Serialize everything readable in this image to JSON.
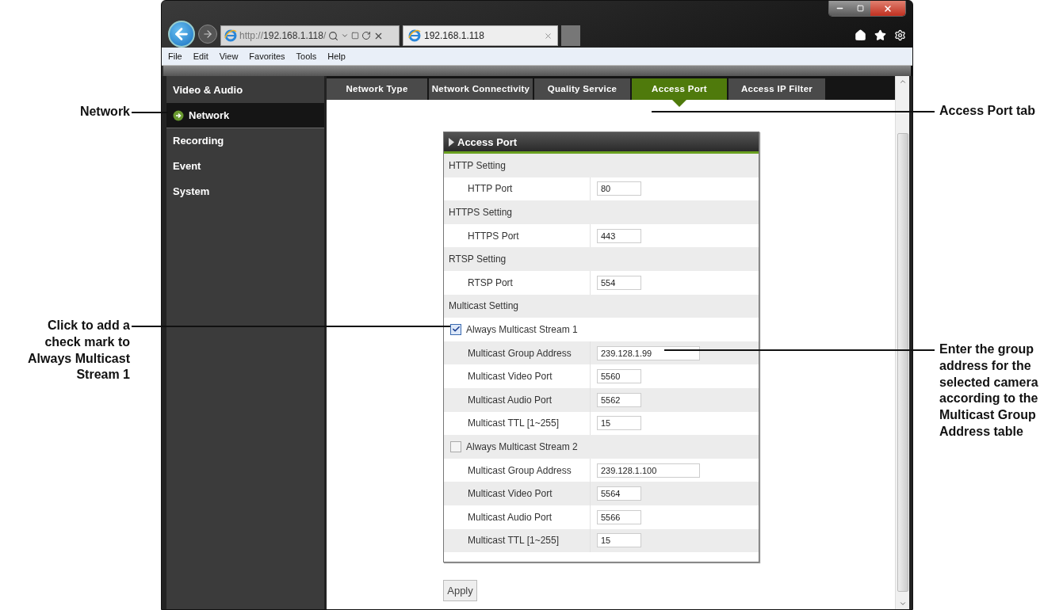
{
  "browser": {
    "address": "http://**192.168.1.118**/",
    "tab_title": "192.168.1.118"
  },
  "menu": [
    "File",
    "Edit",
    "View",
    "Favorites",
    "Tools",
    "Help"
  ],
  "sidebar": [
    {
      "label": "Video & Audio",
      "selected": false
    },
    {
      "label": "Network",
      "selected": true
    },
    {
      "label": "Recording",
      "selected": false
    },
    {
      "label": "Event",
      "selected": false
    },
    {
      "label": "System",
      "selected": false
    }
  ],
  "tabs": [
    {
      "label": "Network Type",
      "selected": false
    },
    {
      "label": "Network Connectivity",
      "selected": false
    },
    {
      "label": "Quality Service",
      "selected": false
    },
    {
      "label": "Access Port",
      "selected": true
    },
    {
      "label": "Access IP Filter",
      "selected": false
    }
  ],
  "panel": {
    "title": "Access Port",
    "rows": [
      {
        "kind": "section",
        "label": "HTTP Setting"
      },
      {
        "kind": "field",
        "label": "HTTP Port",
        "value": "80"
      },
      {
        "kind": "section",
        "label": "HTTPS Setting"
      },
      {
        "kind": "field",
        "label": "HTTPS Port",
        "value": "443"
      },
      {
        "kind": "section",
        "label": "RTSP Setting"
      },
      {
        "kind": "field",
        "label": "RTSP Port",
        "value": "554"
      },
      {
        "kind": "section",
        "label": "Multicast Setting"
      },
      {
        "kind": "checkbox",
        "label": "Always Multicast Stream 1",
        "checked": true
      },
      {
        "kind": "field",
        "label": "Multicast Group Address",
        "value": "239.128.1.99",
        "wide": true
      },
      {
        "kind": "field",
        "label": "Multicast Video Port",
        "value": "5560"
      },
      {
        "kind": "field",
        "label": "Multicast Audio Port",
        "value": "5562"
      },
      {
        "kind": "field",
        "label": "Multicast TTL [1~255]",
        "value": "15"
      },
      {
        "kind": "checkbox",
        "label": "Always Multicast Stream 2",
        "checked": false
      },
      {
        "kind": "field",
        "label": "Multicast Group Address",
        "value": "239.128.1.100",
        "wide": true
      },
      {
        "kind": "field",
        "label": "Multicast Video Port",
        "value": "5564"
      },
      {
        "kind": "field",
        "label": "Multicast Audio Port",
        "value": "5566"
      },
      {
        "kind": "field",
        "label": "Multicast TTL [1~255]",
        "value": "15"
      }
    ]
  },
  "apply": "Apply",
  "annotations": [
    {
      "kind": "left",
      "text": "Network"
    },
    {
      "kind": "left",
      "text": "Click to add a check mark to Always Multicast Stream 1"
    },
    {
      "kind": "right",
      "text": "Access Port tab"
    },
    {
      "kind": "right",
      "text": "Enter the group address for the selected camera according to the Multicast Group Address table"
    }
  ]
}
